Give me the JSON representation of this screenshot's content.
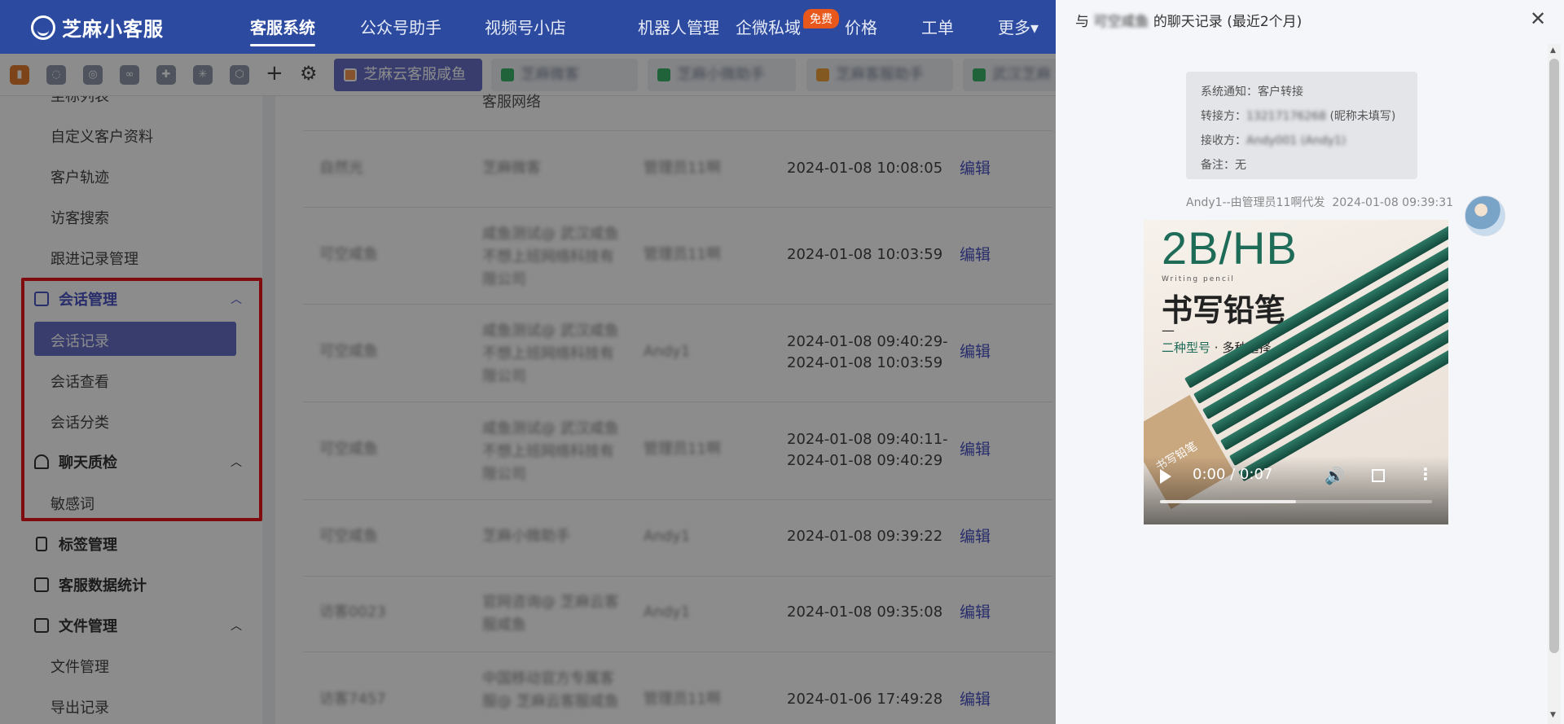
{
  "app": {
    "name": "芝麻小客服"
  },
  "nav": {
    "items": [
      "客服系统",
      "公众号助手",
      "视频号小店",
      "机器人管理",
      "企微私域",
      "价格",
      "工单",
      "更多▾"
    ],
    "free_badge": "免费"
  },
  "toolbar": {
    "tool_icons": [
      "phone-icon",
      "chat-icon",
      "recycle-icon",
      "link-icon",
      "puzzle-icon",
      "asterisk-icon",
      "cube-icon"
    ],
    "tabs": [
      "芝麻云客服咸鱼",
      "芝麻微客",
      "芝麻小微助手",
      "芝麻客服助手",
      "武汉芝麻云"
    ]
  },
  "sidebar": {
    "items": {
      "top_partial": "坐标列表",
      "custom_profile": "自定义客户资料",
      "trajectory": "客户轨迹",
      "visitor_search": "访客搜索",
      "followup": "跟进记录管理",
      "session_group": "会话管理",
      "session_records": "会话记录",
      "session_view": "会话查看",
      "session_category": "会话分类",
      "qc_group": "聊天质检",
      "sensitive": "敏感词",
      "tag_group": "标签管理",
      "stats_group": "客服数据统计",
      "file_group": "文件管理",
      "file_mgmt": "文件管理",
      "export": "导出记录"
    }
  },
  "table": {
    "header_partial": "客服网络",
    "rows": [
      {
        "customer": "自然光",
        "account": "芝麻微客",
        "agent": "管理员11啊",
        "time1": "2024-01-08 10:08:05",
        "time2": "",
        "action": "编辑"
      },
      {
        "customer": "可空咸鱼",
        "account": "咸鱼测试@ 武汉咸鱼不想上班网络科技有限公司",
        "agent": "管理员11啊",
        "time1": "2024-01-08 10:03:59",
        "time2": "",
        "action": "编辑"
      },
      {
        "customer": "可空咸鱼",
        "account": "咸鱼测试@ 武汉咸鱼不想上班网络科技有限公司",
        "agent": "Andy1",
        "time1": "2024-01-08 09:40:29-",
        "time2": "2024-01-08 10:03:59",
        "action": "编辑"
      },
      {
        "customer": "可空咸鱼",
        "account": "咸鱼测试@ 武汉咸鱼不想上班网络科技有限公司",
        "agent": "管理员11啊",
        "time1": "2024-01-08 09:40:11-",
        "time2": "2024-01-08 09:40:29",
        "action": "编辑"
      },
      {
        "customer": "可空咸鱼",
        "account": "芝麻小微助手",
        "agent": "Andy1",
        "time1": "2024-01-08 09:39:22",
        "time2": "",
        "action": "编辑"
      },
      {
        "customer": "访客0023",
        "account": "官网咨询@ 芝麻云客服咸鱼",
        "agent": "Andy1",
        "time1": "2024-01-08 09:35:08",
        "time2": "",
        "action": "编辑"
      },
      {
        "customer": "访客7457",
        "account": "中国移动官方专属客服@ 芝麻云客服咸鱼",
        "agent": "管理员11啊",
        "time1": "2024-01-06 17:49:28",
        "time2": "",
        "action": "编辑"
      }
    ]
  },
  "drawer": {
    "title_prefix": "与",
    "title_name": "可空咸鱼",
    "title_suffix": "的聊天记录 (最近2个月)",
    "system": {
      "line1": "系统通知：客户转接",
      "line2_label": "转接方：",
      "line2_value": "13217176268",
      "line2_note": "(昵称未填写)",
      "line3_label": "接收方：",
      "line3_value": "Andy001 (Andy1)",
      "line4": "备注：无"
    },
    "sender": "Andy1--由管理员11啊代发",
    "timestamp": "2024-01-08 09:39:31",
    "video": {
      "title": "2B/HB",
      "subtitle": "Writing pencil",
      "cn_title": "书写铅笔",
      "dash": "—",
      "model_hl": "二种型号",
      "model_rest": " · 多种选择",
      "box_label": "书写铅笔",
      "time": "0:00 / 0:07",
      "progress": 0.5
    }
  }
}
